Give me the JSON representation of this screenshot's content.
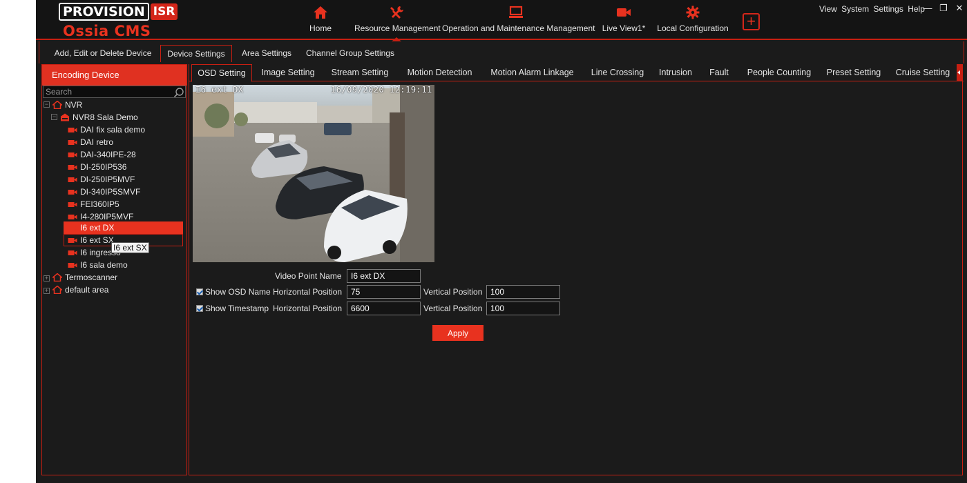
{
  "brand": {
    "logo_main": "PROVISION",
    "logo_badge": "ISR",
    "product": "Ossia CMS",
    "accent_color": "#e8321f"
  },
  "nav": {
    "items": [
      {
        "label": "Home",
        "icon": "home-icon"
      },
      {
        "label": "Resource Management",
        "icon": "tools-icon"
      },
      {
        "label": "Operation and Maintenance Management",
        "icon": "monitor-icon"
      },
      {
        "label": "Live View1*",
        "icon": "video-camera-icon"
      },
      {
        "label": "Local Configuration",
        "icon": "gear-icon"
      }
    ],
    "active": "Resource Management",
    "add_label": "+"
  },
  "system_menu": {
    "view": "View",
    "system": "System",
    "settings": "Settings",
    "help": "Help"
  },
  "window_controls": {
    "minimize": "—",
    "restore": "❐",
    "close": "✕"
  },
  "subtabs": [
    "Add, Edit or Delete Device",
    "Device Settings",
    "Area Settings",
    "Channel Group Settings"
  ],
  "subtab_active": "Device Settings",
  "left_panel": {
    "title": "Encoding Device",
    "search_placeholder": "Search",
    "tree": [
      {
        "label": "NVR",
        "type": "area",
        "level": 0,
        "expanded": true
      },
      {
        "label": "NVR8 Sala Demo",
        "type": "nvr",
        "level": 1,
        "expanded": true
      },
      {
        "label": "DAI fix sala demo",
        "type": "camera",
        "level": 2
      },
      {
        "label": "DAI retro",
        "type": "camera",
        "level": 2
      },
      {
        "label": "DAI-340IPE-28",
        "type": "camera",
        "level": 2
      },
      {
        "label": "DI-250IP536",
        "type": "camera",
        "level": 2
      },
      {
        "label": "DI-250IP5MVF",
        "type": "camera",
        "level": 2
      },
      {
        "label": "DI-340IP5SMVF",
        "type": "camera",
        "level": 2
      },
      {
        "label": "FEI360IP5",
        "type": "camera",
        "level": 2
      },
      {
        "label": "I4-280IP5MVF",
        "type": "camera",
        "level": 2
      },
      {
        "label": "I6 ext DX",
        "type": "camera",
        "level": 2,
        "selected": true
      },
      {
        "label": "I6 ext SX",
        "type": "camera",
        "level": 2,
        "hover": true
      },
      {
        "label": "I6 ingresso",
        "type": "camera",
        "level": 2
      },
      {
        "label": "I6 sala demo",
        "type": "camera",
        "level": 2
      },
      {
        "label": "Termoscanner",
        "type": "area",
        "level": 0,
        "expanded": false
      },
      {
        "label": "default area",
        "type": "area",
        "level": 0,
        "expanded": false
      }
    ],
    "tooltip": "I6 ext SX"
  },
  "settings_tabs": [
    "OSD Setting",
    "Image Setting",
    "Stream Setting",
    "Motion Detection",
    "Motion Alarm Linkage",
    "Line Crossing",
    "Intrusion",
    "Fault",
    "People Counting",
    "Preset Setting",
    "Cruise Setting"
  ],
  "settings_tab_active": "OSD Setting",
  "preview": {
    "osd_name": "I6 ext DX",
    "osd_timestamp": "16/09/2020 12:19:11"
  },
  "osd_form": {
    "video_point_name_label": "Video Point Name",
    "video_point_name": "I6 ext DX",
    "show_osd_name_label": "Show OSD Name",
    "show_osd_name": true,
    "show_timestamp_label": "Show Timestamp",
    "show_timestamp": true,
    "horizontal_position_label": "Horizontal Position",
    "vertical_position_label": "Vertical Position",
    "osd_name_horizontal": "75",
    "osd_name_vertical": "100",
    "timestamp_horizontal": "6600",
    "timestamp_vertical": "100",
    "apply_label": "Apply"
  }
}
